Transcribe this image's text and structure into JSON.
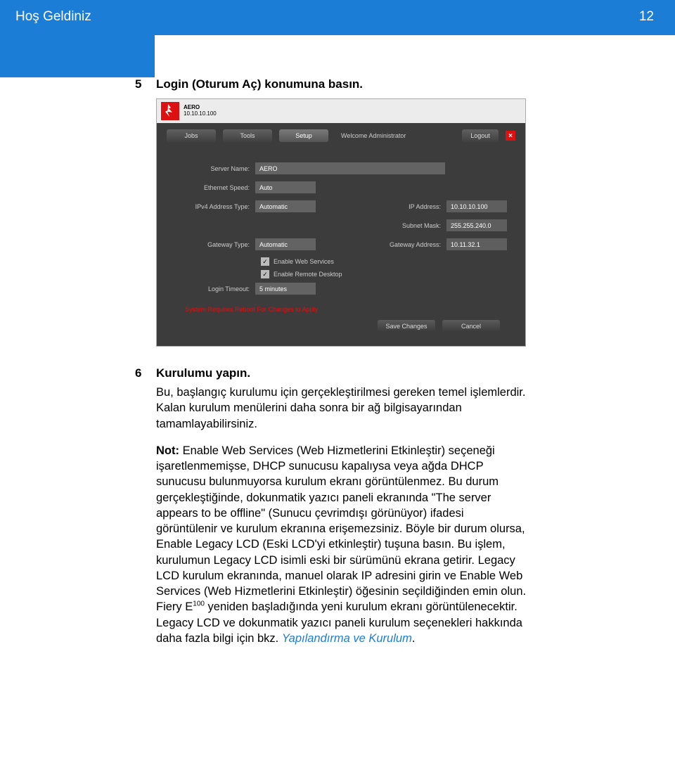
{
  "header": {
    "title": "Hoş Geldiniz",
    "page_number": "12"
  },
  "steps": {
    "s5": {
      "num": "5",
      "label": "Login (Oturum Aç) konumuna basın."
    },
    "s6": {
      "num": "6",
      "label": "Kurulumu yapın."
    }
  },
  "ui": {
    "product": "AERO",
    "ip_top": "10.10.10.100",
    "tabs": {
      "jobs": "Jobs",
      "tools": "Tools",
      "setup": "Setup"
    },
    "welcome": "Welcome Administrator",
    "logout": "Logout",
    "close_x": "×",
    "labels": {
      "server_name": "Server Name:",
      "ethernet_speed": "Ethernet Speed:",
      "ipv4_type": "IPv4 Address Type:",
      "ip_address": "IP Address:",
      "subnet_mask": "Subnet Mask:",
      "gateway_type": "Gateway Type:",
      "gateway_address": "Gateway Address:",
      "login_timeout": "Login Timeout:"
    },
    "values": {
      "server_name": "AERO",
      "ethernet_speed": "Auto",
      "ipv4_type": "Automatic",
      "ip_address": "10.10.10.100",
      "subnet_mask": "255.255.240.0",
      "gateway_type": "Automatic",
      "gateway_address": "10.11.32.1",
      "login_timeout": "5 minutes"
    },
    "checks": {
      "c1": "✓",
      "c1_label": "Enable Web Services",
      "c2": "✓",
      "c2_label": "Enable Remote Desktop"
    },
    "warning": "System Requires Reboot For Changes to Apply",
    "buttons": {
      "save": "Save Changes",
      "cancel": "Cancel"
    }
  },
  "body": {
    "p1": "Bu, başlangıç kurulumu için gerçekleştirilmesi gereken temel işlemlerdir. Kalan kurulum menülerini daha sonra bir ağ bilgisayarından tamamlayabilirsiniz.",
    "note_label": "Not:",
    "note_1": " Enable Web Services (Web Hizmetlerini Etkinleştir) seçeneği işaretlenmemişse, DHCP sunucusu kapalıysa veya ağda DHCP sunucusu bulunmuyorsa kurulum ekranı görüntülenmez. Bu durum gerçekleştiğinde, dokunmatik yazıcı paneli ekranında \"The server appears to be offline\" (Sunucu çevrimdışı görünüyor) ifadesi görüntülenir ve kurulum ekranına erişemezsiniz. Böyle bir durum olursa, Enable Legacy LCD (Eski LCD'yi etkinleştir) tuşuna basın. Bu işlem, kurulumun Legacy LCD isimli eski bir sürümünü ekrana getirir. Legacy LCD kurulum ekranında, manuel olarak IP adresini girin ve Enable Web Services (Web Hizmetlerini Etkinleştir) öğesinin seçildiğinden emin olun.",
    "note_2a": "Fiery E",
    "note_2sup": "100",
    "note_2b": " yeniden başladığında yeni kurulum ekranı görüntülenecektir.",
    "note_3a": "Legacy LCD ve dokunmatik yazıcı paneli kurulum seçenekleri hakkında daha fazla bilgi için bkz. ",
    "note_link": "Yapılandırma ve Kurulum",
    "note_3b": "."
  }
}
